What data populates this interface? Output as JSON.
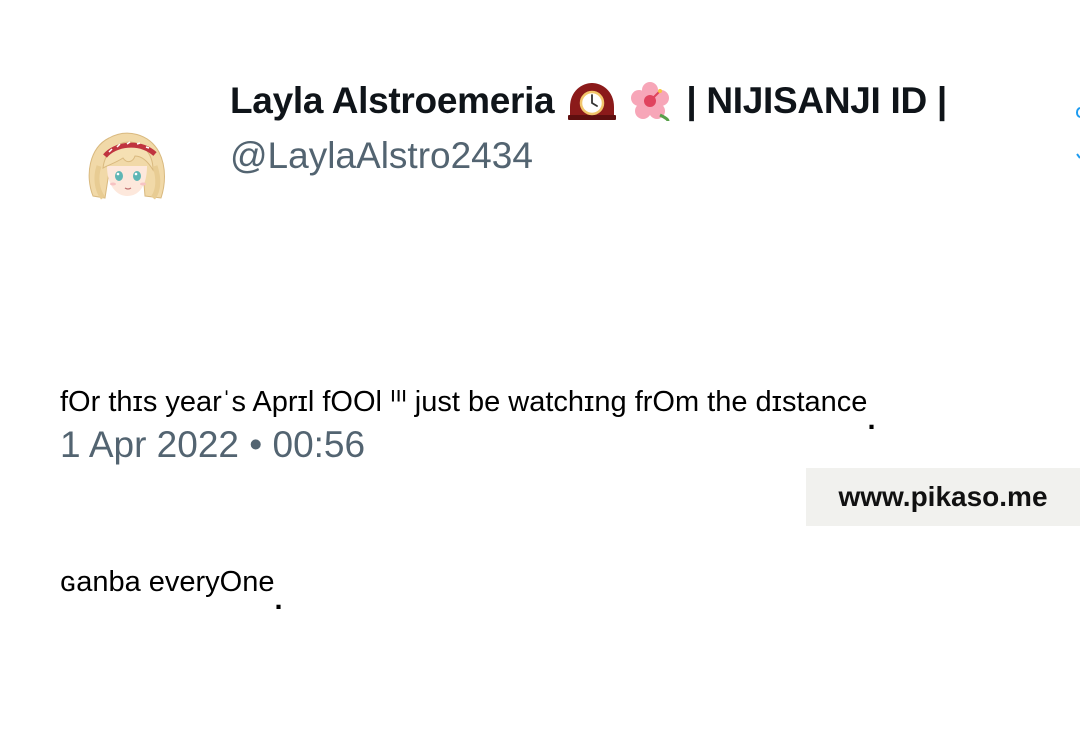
{
  "profile": {
    "display_name": "Layla Alstroemeria",
    "emoji_1": "mantelpiece-clock-icon",
    "emoji_2": "hibiscus-icon",
    "name_suffix": "| NIJISANJI ID |",
    "handle": "@LaylaAlstro2434",
    "avatar": "anime-avatar-icon"
  },
  "tweet": {
    "lines": [
      "fOr thɪs yearˈs Aprɪl fOOl ᑊᑊᑊ just be watchɪng frOm the dɪstance",
      "ɢanba everyOne"
    ],
    "line_end_mark": "."
  },
  "meta": {
    "timestamp": "1 Apr 2022 • 00:56"
  },
  "watermark": {
    "text": "www.pikaso.me"
  },
  "colors": {
    "name": "#0f1419",
    "secondary": "#536471",
    "accent": "#1d9bf0",
    "watermark_bg": "#f1f1ee"
  }
}
